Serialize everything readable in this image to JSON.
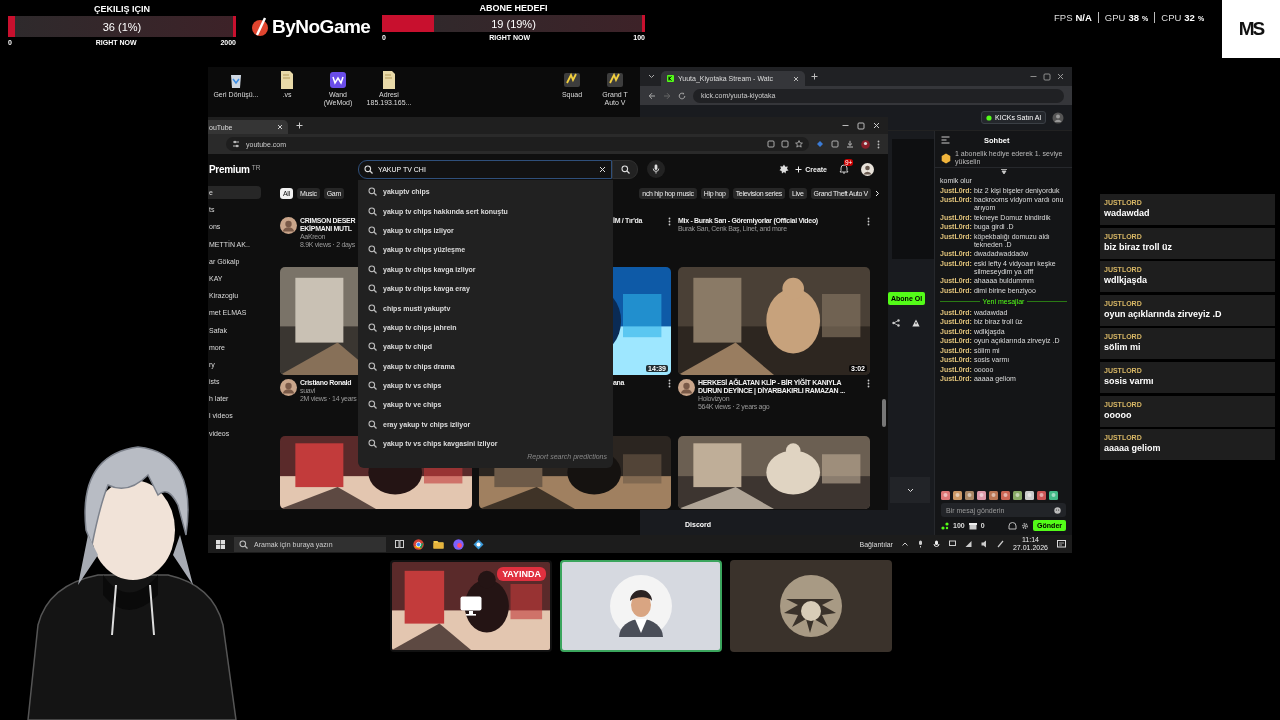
{
  "goals": [
    {
      "title": "ÇEKILIŞ IÇIN",
      "reading": "36 (1%)",
      "level": 0.018,
      "min": "0",
      "now": "RIGHT NOW",
      "max": "2000"
    },
    {
      "title": "ABONE HEDEFI",
      "reading": "19 (19%)",
      "level": 0.19,
      "min": "0",
      "now": "RIGHT NOW",
      "max": "100"
    }
  ],
  "brand": {
    "name": "ByNoGame"
  },
  "stats": [
    {
      "label": "FPS",
      "value": "N/A"
    },
    {
      "label": "GPU",
      "value": "38",
      "unit": "%"
    },
    {
      "label": "CPU",
      "value": "32",
      "unit": "%"
    }
  ],
  "corner_logo": {
    "mark": "MS"
  },
  "desktop": {
    "icons_left": [
      {
        "label": "Geri Dönüşü...",
        "kind": "bin"
      },
      {
        "label": ".vs",
        "kind": "file"
      },
      {
        "label": "Wand (WeMod)",
        "kind": "app"
      },
      {
        "label": "Adresi 185.193.165...",
        "kind": "file"
      }
    ],
    "icons_right": [
      {
        "label": "Squad",
        "kind": "game"
      },
      {
        "label": "Grand T Auto V",
        "kind": "game"
      }
    ]
  },
  "kick": {
    "tab": "Yuuta_Kiyotaka Stream - Watc",
    "url": "kick.com/yuuta-kiyotaka",
    "buy_button": "KICKs Satın Al",
    "follow_button": "Abone Ol",
    "discord_label": "Discord",
    "chat": {
      "title": "Sohbet",
      "promo": "1 abonelik hediye ederek 1. seviye yükselin",
      "divider": "Yeni mesajlar",
      "placeholder": "Bir mesaj gönderin",
      "points": "100",
      "count": "0",
      "send": "Gönder",
      "earlier": [
        {
          "text": "komik olur"
        },
        {
          "user": "JustL0rd:",
          "text": "biz 2 kişi bişeler deniyorduk"
        },
        {
          "user": "JustL0rd:",
          "text": "backrooms vidyom vardı onu arıyom"
        },
        {
          "user": "JustL0rd:",
          "text": "tekneye Domuz bindirdik"
        },
        {
          "user": "JustL0rd:",
          "text": "buga girdi .D"
        },
        {
          "user": "JustL0rd:",
          "text": "köpekbalığı domuzu aldı tekneden .D"
        },
        {
          "user": "JustL0rd:",
          "text": "dwadadwaddadw"
        },
        {
          "user": "JustL0rd:",
          "text": "eski lefty 4 vidyoaırı keşke silmeseydim ya offf"
        },
        {
          "user": "JustL0rd:",
          "text": "ahaaaa buldummm"
        },
        {
          "user": "JustL0rd:",
          "text": "dimi birine benziyoo"
        }
      ],
      "new": [
        {
          "user": "JustL0rd:",
          "text": "wadawdad"
        },
        {
          "user": "JustL0rd:",
          "text": "biz biraz troll üz"
        },
        {
          "user": "JustL0rd:",
          "text": "wdlkjaşda"
        },
        {
          "user": "JustL0rd:",
          "text": "oyun açıklarında zirveyiz .D"
        },
        {
          "user": "JustL0rd:",
          "text": "sölim mi"
        },
        {
          "user": "JustL0rd:",
          "text": "sosis varmı"
        },
        {
          "user": "JustL0rd:",
          "text": "ooooo"
        },
        {
          "user": "JustL0rd:",
          "text": "aaaaa geliom"
        }
      ]
    }
  },
  "youtube": {
    "tab": "ouTube",
    "url": "youtube.com",
    "brand": "Premium",
    "country": "TR",
    "search": {
      "value": "YAKUP TV CHI"
    },
    "create": "Create",
    "notifications": "9+",
    "sidebar": [
      {
        "label": "e",
        "selected": true
      },
      {
        "label": "ts",
        "selected": false
      },
      {
        "label": "ons",
        "selected": false
      },
      {
        "label": "METTİN AK..",
        "selected": false
      },
      {
        "label": "ar Gökalp",
        "selected": false
      },
      {
        "label": "KAY",
        "selected": false
      },
      {
        "label": "Kirazoglu",
        "selected": false
      },
      {
        "label": "met ELMAS",
        "selected": false
      },
      {
        "label": "Safak",
        "selected": false
      },
      {
        "label": "more",
        "selected": false
      },
      {
        "label": "ry",
        "selected": false
      },
      {
        "label": "ists",
        "selected": false
      },
      {
        "label": "h later",
        "selected": false
      },
      {
        "label": "l videos",
        "selected": false
      },
      {
        "label": "videos",
        "selected": false
      }
    ],
    "chips_left": [
      {
        "label": "All",
        "selected": true
      },
      {
        "label": "Music",
        "selected": false
      },
      {
        "label": "Gam",
        "selected": false
      }
    ],
    "chips_right": [
      {
        "label": "nch hip hop music",
        "selected": false
      },
      {
        "label": "Hip hop",
        "selected": false
      },
      {
        "label": "Television series",
        "selected": false
      },
      {
        "label": "Live",
        "selected": false
      },
      {
        "label": "Grand Theft Auto V",
        "selected": false
      }
    ],
    "suggestions": [
      "yakuptv chips",
      "yakup tv chips hakkında sert konuştu",
      "yakup tv chips izliyor",
      "yakup tv chips yüzleşme",
      "yakup tv chips kavga izliyor",
      "yakup tv chips kavga eray",
      "chips musti yakuptv",
      "yakup tv chips jahrein",
      "yakup tv chipd",
      "yakup tv chips drama",
      "yakup tv vs chips",
      "yakup tv ve chips",
      "eray yakup tv chips izliyor",
      "yakup tv vs chips kavgasini izliyor"
    ],
    "report": "Report search predictions",
    "rows": [
      {
        "videos": [
          {
            "thumbnail": false,
            "avatar": true,
            "title_lines": [
              "CRIMSON DESER",
              "EKİPMANI MUTL"
            ],
            "channel": "AaKreon",
            "meta": "8.9K views · 2 days"
          },
          {
            "thumbnail": false,
            "partial": true,
            "menu": true,
            "title_lines": [
              "İM / Tır'da"
            ]
          },
          {
            "thumbnail": false,
            "menu": true,
            "title_lines": [
              "Mix - Burak Sarı - Göremiyorlar (Official Video)"
            ],
            "channel": "Burak Sarı, Cenk Baş, Linet, and more"
          }
        ]
      },
      {
        "videos": [
          {
            "thumbnail": true,
            "avatar": true,
            "title_lines": [
              "Cristiano Ronald"
            ],
            "channel": "suavi",
            "meta": "2M views · 14 years"
          },
          {
            "thumbnail": true,
            "partial": true,
            "menu": true,
            "duration": "14:39",
            "title_lines": [
              "ana"
            ]
          },
          {
            "thumbnail": true,
            "avatar": true,
            "menu": true,
            "duration": "3:02",
            "title_lines": [
              "HERKESİ AĞLATAN KLİP - BİR YİĞİT KANIYLA",
              "DURUN DEYİNCE | DİYARBAKIRLI RAMAZAN ..."
            ],
            "channel": "Holovizyon",
            "meta": "564K views · 2 years ago"
          }
        ]
      },
      {
        "videos": [
          {
            "thumbnail": true
          },
          {
            "thumbnail": true
          },
          {
            "thumbnail": true
          }
        ]
      }
    ]
  },
  "taskbar": {
    "search_placeholder": "Aramak için buraya yazın",
    "links": "Bağlantılar",
    "time": "11:14",
    "date": "27.01.2026"
  },
  "call": {
    "tiles": [
      {
        "kind": "screen",
        "badge": "YAYINDA",
        "selected": false
      },
      {
        "kind": "avatar",
        "selected": true
      },
      {
        "kind": "avatar",
        "selected": false
      }
    ]
  },
  "chat_overlay": [
    {
      "user": "JUSTLORD",
      "text": "wadawdad"
    },
    {
      "user": "JUSTLORD",
      "text": "biz biraz troll üz"
    },
    {
      "user": "JUSTLORD",
      "text": "wdlkjaşda"
    },
    {
      "user": "JUSTLORD",
      "text": "oyun açıklarında zirveyiz .D"
    },
    {
      "user": "JUSTLORD",
      "text": "sölim mi"
    },
    {
      "user": "JUSTLORD",
      "text": "sosis varmı"
    },
    {
      "user": "JUSTLORD",
      "text": "ooooo"
    },
    {
      "user": "JUSTLORD",
      "text": "aaaaa geliom"
    }
  ]
}
